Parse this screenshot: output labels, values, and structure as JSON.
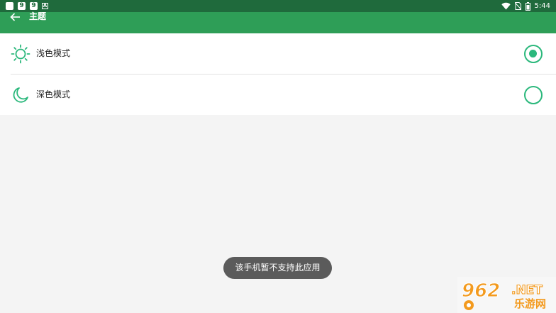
{
  "status_bar": {
    "notif_icons": [
      "9",
      "9"
    ],
    "time": "5:44"
  },
  "app_bar": {
    "title": "主题"
  },
  "theme_options": [
    {
      "label": "浅色模式",
      "icon": "sun-icon",
      "selected": true
    },
    {
      "label": "深色模式",
      "icon": "moon-icon",
      "selected": false
    }
  ],
  "toast": {
    "message": "该手机暂不支持此应用"
  },
  "watermark": {
    "number": "962",
    "domain": ".NET",
    "site_name": "乐游网"
  },
  "colors": {
    "status_bar": "#1f6a3c",
    "app_bar": "#2e9e57",
    "accent": "#2bb87c",
    "background": "#f4f4f4"
  }
}
